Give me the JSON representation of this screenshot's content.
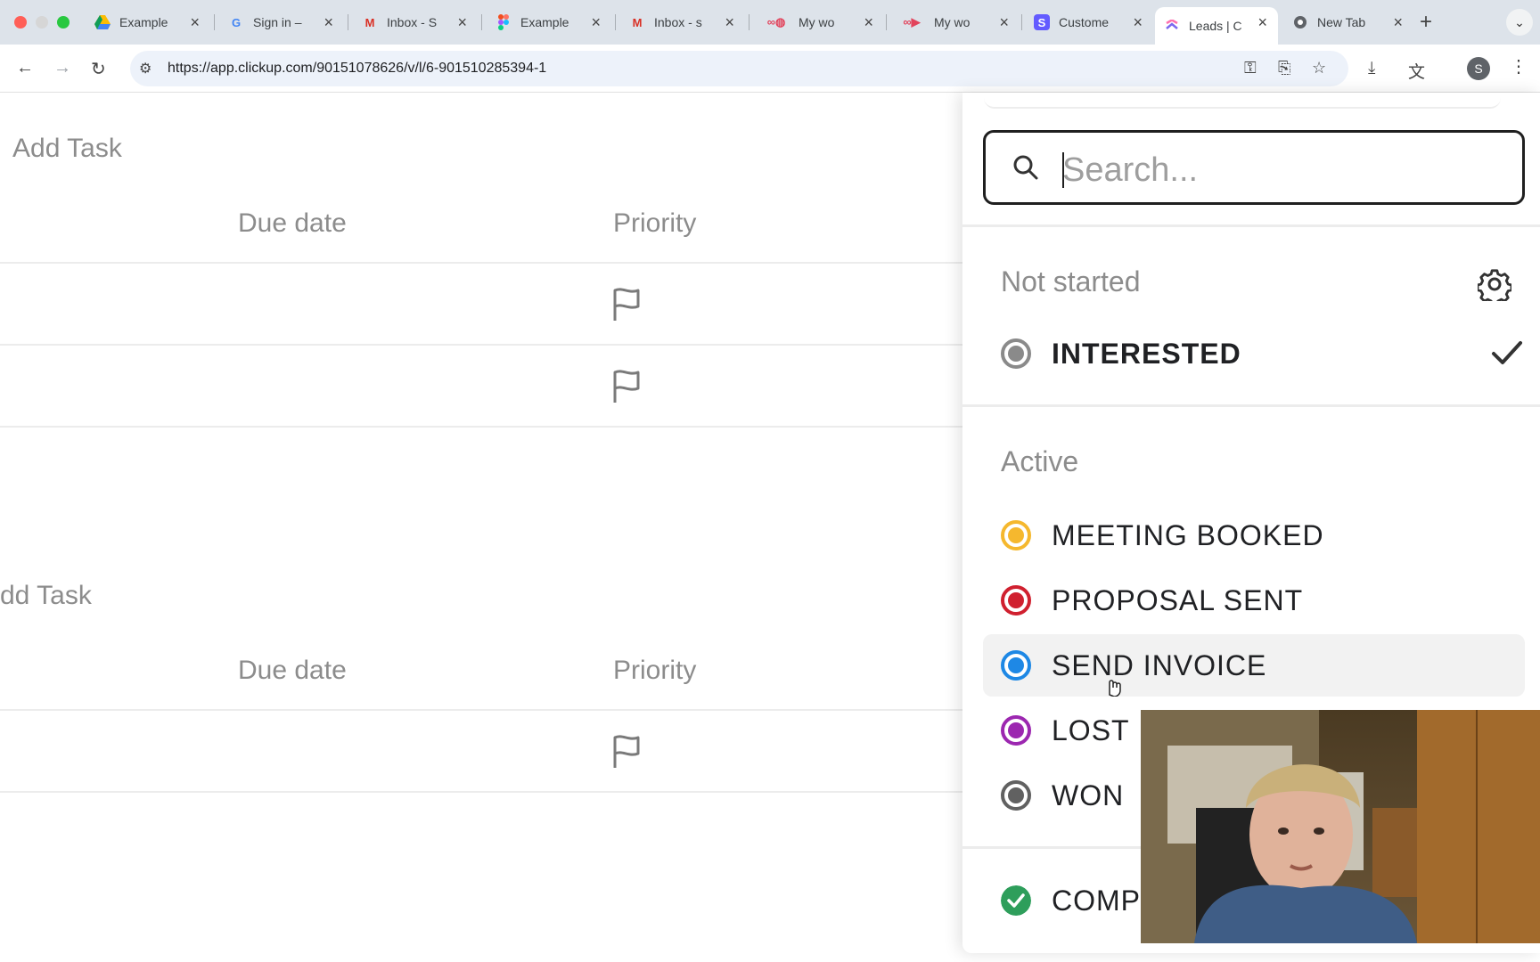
{
  "browser": {
    "tabs": [
      {
        "title": "Example",
        "icon": "google-drive-icon",
        "color": "#1a73e8"
      },
      {
        "title": "Sign in –",
        "icon": "google-icon",
        "color": "#4285f4"
      },
      {
        "title": "Inbox - S",
        "icon": "gmail-icon",
        "color": "#d93025"
      },
      {
        "title": "Example",
        "icon": "figma-icon",
        "color": "#f24e1e"
      },
      {
        "title": "Inbox - s",
        "icon": "gmail-icon",
        "color": "#d93025"
      },
      {
        "title": "My wo",
        "icon": "monday-icon",
        "color": "#e2445c"
      },
      {
        "title": "My wo",
        "icon": "monday-icon",
        "color": "#e2445c"
      },
      {
        "title": "Custome",
        "icon": "stripe-icon",
        "color": "#635bff"
      },
      {
        "title": "Leads | C",
        "icon": "clickup-icon",
        "color": "#7b68ee"
      },
      {
        "title": "New Tab",
        "icon": "chrome-icon",
        "color": "#5f6368"
      }
    ],
    "url": "https://app.clickup.com/90151078626/v/l/6-901510285394-1",
    "profile_initial": "S"
  },
  "list": {
    "group1": {
      "add_task": "Add Task",
      "columns": {
        "due_date": "Due date",
        "priority": "Priority"
      }
    },
    "group2": {
      "add_task": "dd Task",
      "columns": {
        "due_date": "Due date",
        "priority": "Priority"
      }
    }
  },
  "dropdown": {
    "search_placeholder": "Search...",
    "groups": [
      {
        "heading": "Not started",
        "statuses": [
          {
            "label": "INTERESTED",
            "color": "#8a8a8a",
            "selected": true
          }
        ]
      },
      {
        "heading": "Active",
        "statuses": [
          {
            "label": "MEETING BOOKED",
            "color": "#f5b82e"
          },
          {
            "label": "PROPOSAL SENT",
            "color": "#d0202f"
          },
          {
            "label": "SEND INVOICE",
            "color": "#1e88e5",
            "hovered": true
          },
          {
            "label": "LOST",
            "color": "#9c27b0"
          },
          {
            "label": "WON",
            "color": "#616161"
          }
        ]
      },
      {
        "heading": "",
        "statuses": [
          {
            "label": "COMP",
            "color": "#2e9e5b"
          }
        ]
      }
    ]
  },
  "colors": {
    "accent_text": "#202124",
    "muted_text": "#8c8c8c",
    "hover_bg": "#f2f2f2"
  }
}
